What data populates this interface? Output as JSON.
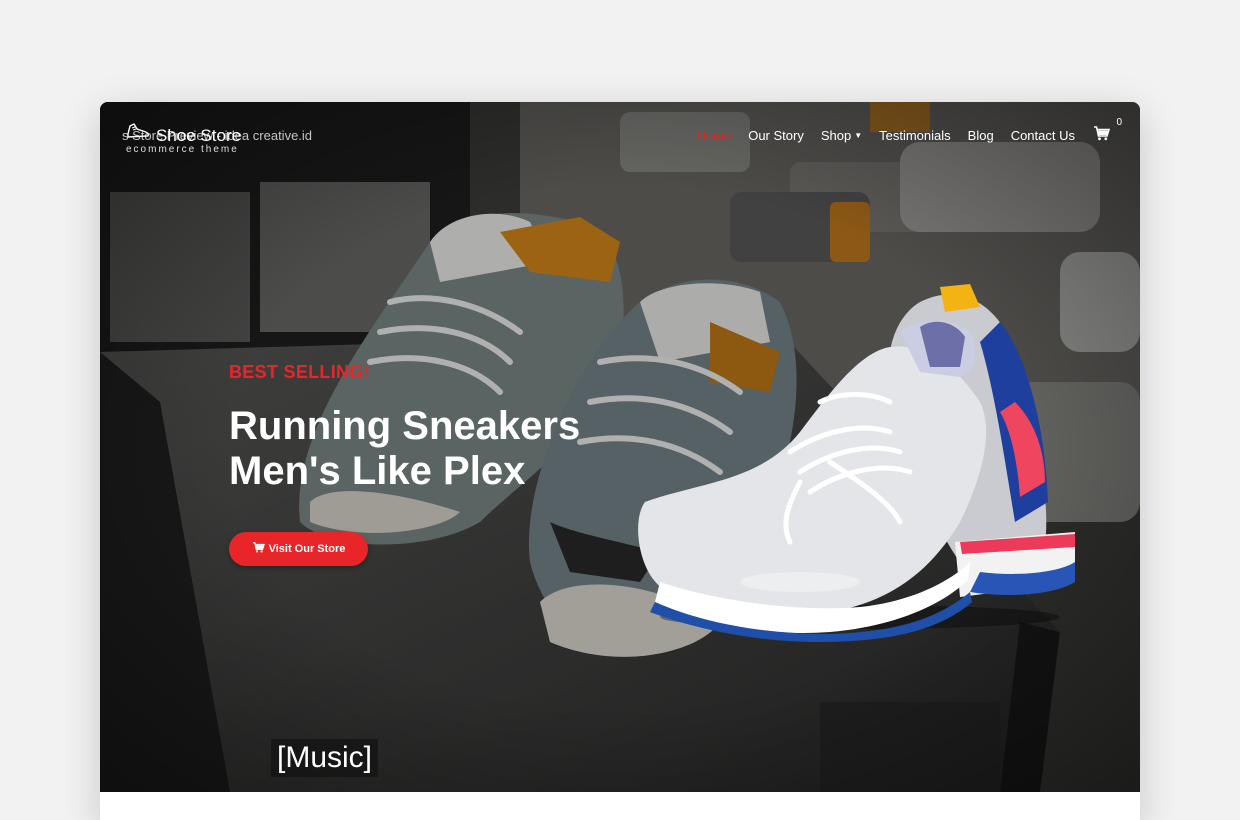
{
  "site": {
    "logo_title": "Shoe Store",
    "logo_subtitle": "ecommerce theme",
    "overlay_text": "s Store Preview - idea creative.id"
  },
  "nav": {
    "items": [
      "Home",
      "Our Story",
      "Shop",
      "Testimonials",
      "Blog",
      "Contact Us"
    ],
    "cart_count": "0"
  },
  "hero": {
    "kicker": "BEST SELLING!",
    "headline_line1": "Running Sneakers",
    "headline_line2": "Men's Like Plex",
    "cta_label": "Visit Our Store"
  },
  "video": {
    "caption": "[Music]"
  },
  "colors": {
    "accent": "#e8262a",
    "page_bg": "#f2f2f2"
  },
  "icons": {
    "logo": "shoe-icon",
    "cart": "cart-icon",
    "shop_dropdown": "caret-down-icon"
  }
}
